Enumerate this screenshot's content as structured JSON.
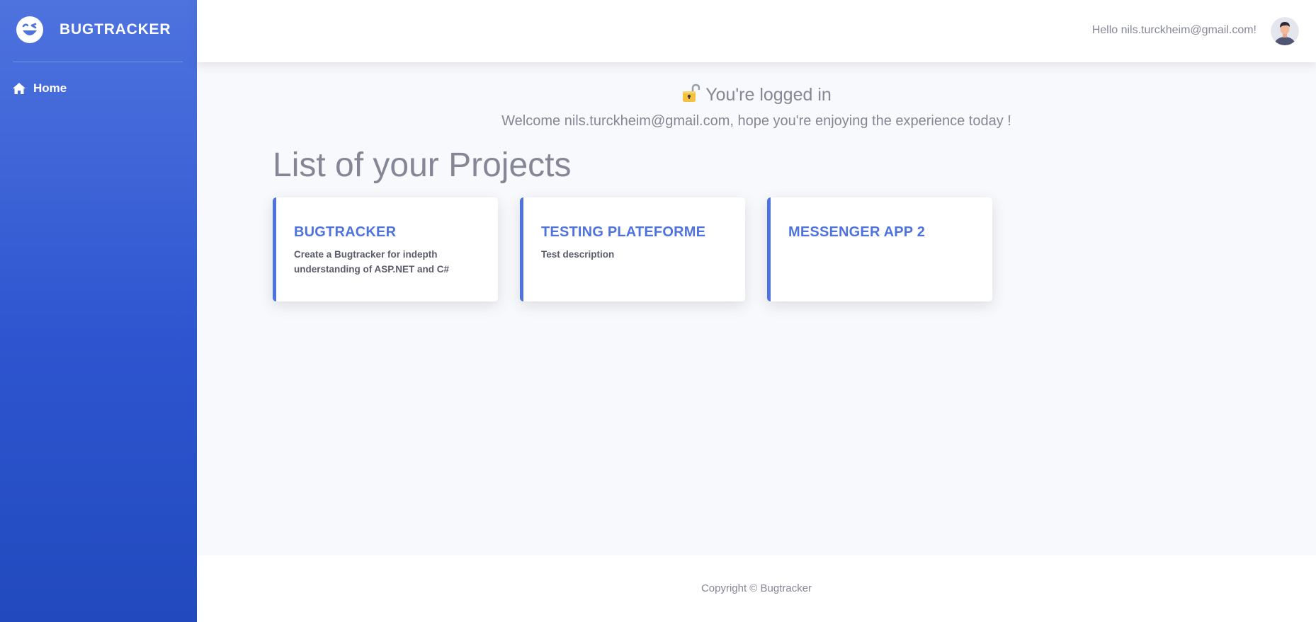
{
  "sidebar": {
    "brand": "BUGTRACKER",
    "brand_icon": "laughing-face-icon",
    "items": [
      {
        "label": "Home",
        "icon": "home-icon"
      }
    ]
  },
  "topbar": {
    "greeting": "Hello nils.turckheim@gmail.com!",
    "avatar_icon": "user-avatar-icon"
  },
  "main": {
    "status_icon": "unlocked-padlock-icon",
    "status_title": "You're logged in",
    "welcome": "Welcome nils.turckheim@gmail.com, hope you're enjoying the experience today !",
    "projects_heading": "List of your Projects",
    "projects": [
      {
        "title": "BUGTRACKER",
        "description": "Create a Bugtracker for indepth understanding of ASP.NET and C#"
      },
      {
        "title": "TESTING PLATEFORME",
        "description": "Test description"
      },
      {
        "title": "MESSENGER APP 2",
        "description": ""
      }
    ]
  },
  "footer": {
    "copyright": "Copyright © Bugtracker"
  },
  "colors": {
    "primary": "#4e73df",
    "primary_dark": "#224abe",
    "text_muted": "#858796",
    "text_dark": "#5a5c69",
    "background": "#f8f9fc"
  }
}
